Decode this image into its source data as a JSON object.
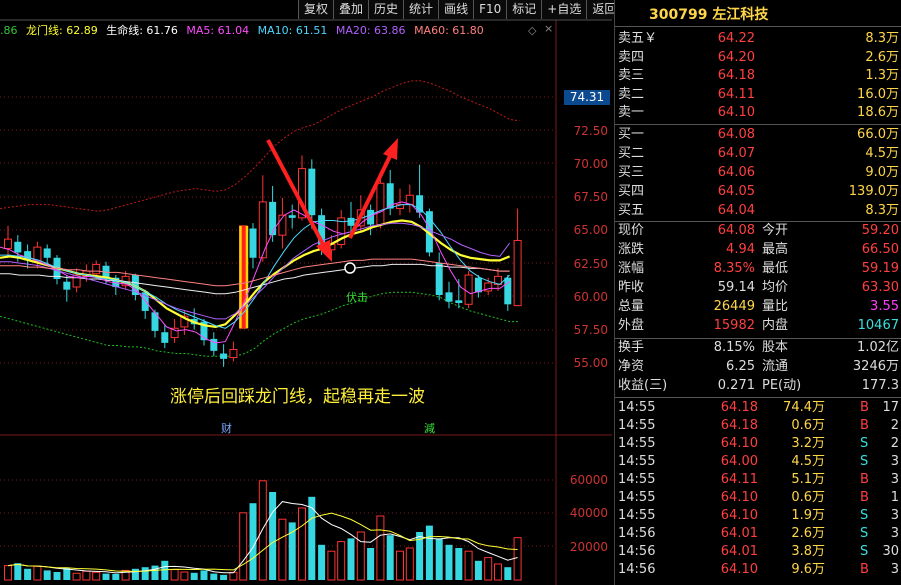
{
  "toolbar": [
    "复权",
    "叠加",
    "历史",
    "统计",
    "画线",
    "F10",
    "标记",
    "+自选",
    "返回"
  ],
  "indicators": [
    {
      "text": ".86",
      "color": "#36c636"
    },
    {
      "text": "龙门线: 62.89",
      "color": "#ffff33"
    },
    {
      "text": "生命线: 61.76",
      "color": "#ffffff"
    },
    {
      "text": "MA5: 61.04",
      "color": "#ff4dff"
    },
    {
      "text": "MA10: 61.51",
      "color": "#4dd7ff"
    },
    {
      "text": "MA20: 63.86",
      "color": "#b060ff"
    },
    {
      "text": "MA60: 61.80",
      "color": "#ff8080"
    }
  ],
  "price_axis": [
    "72.50",
    "70.00",
    "67.50",
    "65.00",
    "62.50",
    "60.00",
    "57.50",
    "55.00"
  ],
  "current_tag": "74.31",
  "volume_axis": [
    "60000",
    "40000",
    "20000"
  ],
  "annotation": "涨停后回踩龙门线，起稳再走一波",
  "marker_fuji": "伏击",
  "marker_cai": "财",
  "marker_jian": "減",
  "stock": {
    "code": "300799",
    "name": "左江科技"
  },
  "asks": [
    {
      "label": "卖五￥",
      "price": "64.22",
      "vol": "8.3万"
    },
    {
      "label": "卖四",
      "price": "64.20",
      "vol": "2.6万"
    },
    {
      "label": "卖三",
      "price": "64.18",
      "vol": "1.3万"
    },
    {
      "label": "卖二",
      "price": "64.11",
      "vol": "16.0万"
    },
    {
      "label": "卖一",
      "price": "64.10",
      "vol": "18.6万"
    }
  ],
  "bids": [
    {
      "label": "买一",
      "price": "64.08",
      "vol": "66.0万"
    },
    {
      "label": "买二",
      "price": "64.07",
      "vol": "4.5万"
    },
    {
      "label": "买三",
      "price": "64.06",
      "vol": "9.0万"
    },
    {
      "label": "买四",
      "price": "64.05",
      "vol": "139.0万"
    },
    {
      "label": "买五",
      "price": "64.04",
      "vol": "8.3万"
    }
  ],
  "quote": [
    {
      "l1": "现价",
      "v1": "64.08",
      "c1": "#ff4040",
      "l2": "今开",
      "v2": "59.20",
      "c2": "#ff4040"
    },
    {
      "l1": "涨跌",
      "v1": "4.94",
      "c1": "#ff4040",
      "l2": "最高",
      "v2": "66.50",
      "c2": "#ff4040"
    },
    {
      "l1": "涨幅",
      "v1": "8.35%",
      "c1": "#ff4040",
      "l2": "最低",
      "v2": "59.19",
      "c2": "#ff4040"
    },
    {
      "l1": "昨收",
      "v1": "59.14",
      "c1": "#dddddd",
      "l2": "均价",
      "v2": "63.30",
      "c2": "#ff4040"
    },
    {
      "l1": "总量",
      "v1": "26449",
      "c1": "#ffd64a",
      "l2": "量比",
      "v2": "3.55",
      "c2": "#ff40ff"
    },
    {
      "l1": "外盘",
      "v1": "15982",
      "c1": "#ff4040",
      "l2": "内盘",
      "v2": "10467",
      "c2": "#36e0e0"
    }
  ],
  "fin": [
    {
      "l1": "换手",
      "v1": "8.15%",
      "l2": "股本",
      "v2": "1.02亿"
    },
    {
      "l1": "净资",
      "v1": "6.25",
      "l2": "流通",
      "v2": "3246万"
    },
    {
      "l1": "收益(三)",
      "v1": "0.271",
      "l2": "PE(动)",
      "v2": "177.3"
    }
  ],
  "ticks": [
    {
      "time": "14:55",
      "price": "64.18",
      "vol": "74.4万",
      "side": "B",
      "n": "17"
    },
    {
      "time": "14:55",
      "price": "64.18",
      "vol": "0.6万",
      "side": "B",
      "n": "2"
    },
    {
      "time": "14:55",
      "price": "64.10",
      "vol": "3.2万",
      "side": "S",
      "n": "2"
    },
    {
      "time": "14:55",
      "price": "64.00",
      "vol": "4.5万",
      "side": "S",
      "n": "3"
    },
    {
      "time": "14:55",
      "price": "64.11",
      "vol": "5.1万",
      "side": "B",
      "n": "3"
    },
    {
      "time": "14:55",
      "price": "64.10",
      "vol": "0.6万",
      "side": "B",
      "n": "1"
    },
    {
      "time": "14:55",
      "price": "64.10",
      "vol": "1.9万",
      "side": "S",
      "n": "3"
    },
    {
      "time": "14:56",
      "price": "64.01",
      "vol": "2.6万",
      "side": "S",
      "n": "3"
    },
    {
      "time": "14:56",
      "price": "64.01",
      "vol": "3.8万",
      "side": "S",
      "n": "30"
    },
    {
      "time": "14:56",
      "price": "64.10",
      "vol": "9.6万",
      "side": "B",
      "n": "3"
    }
  ]
}
